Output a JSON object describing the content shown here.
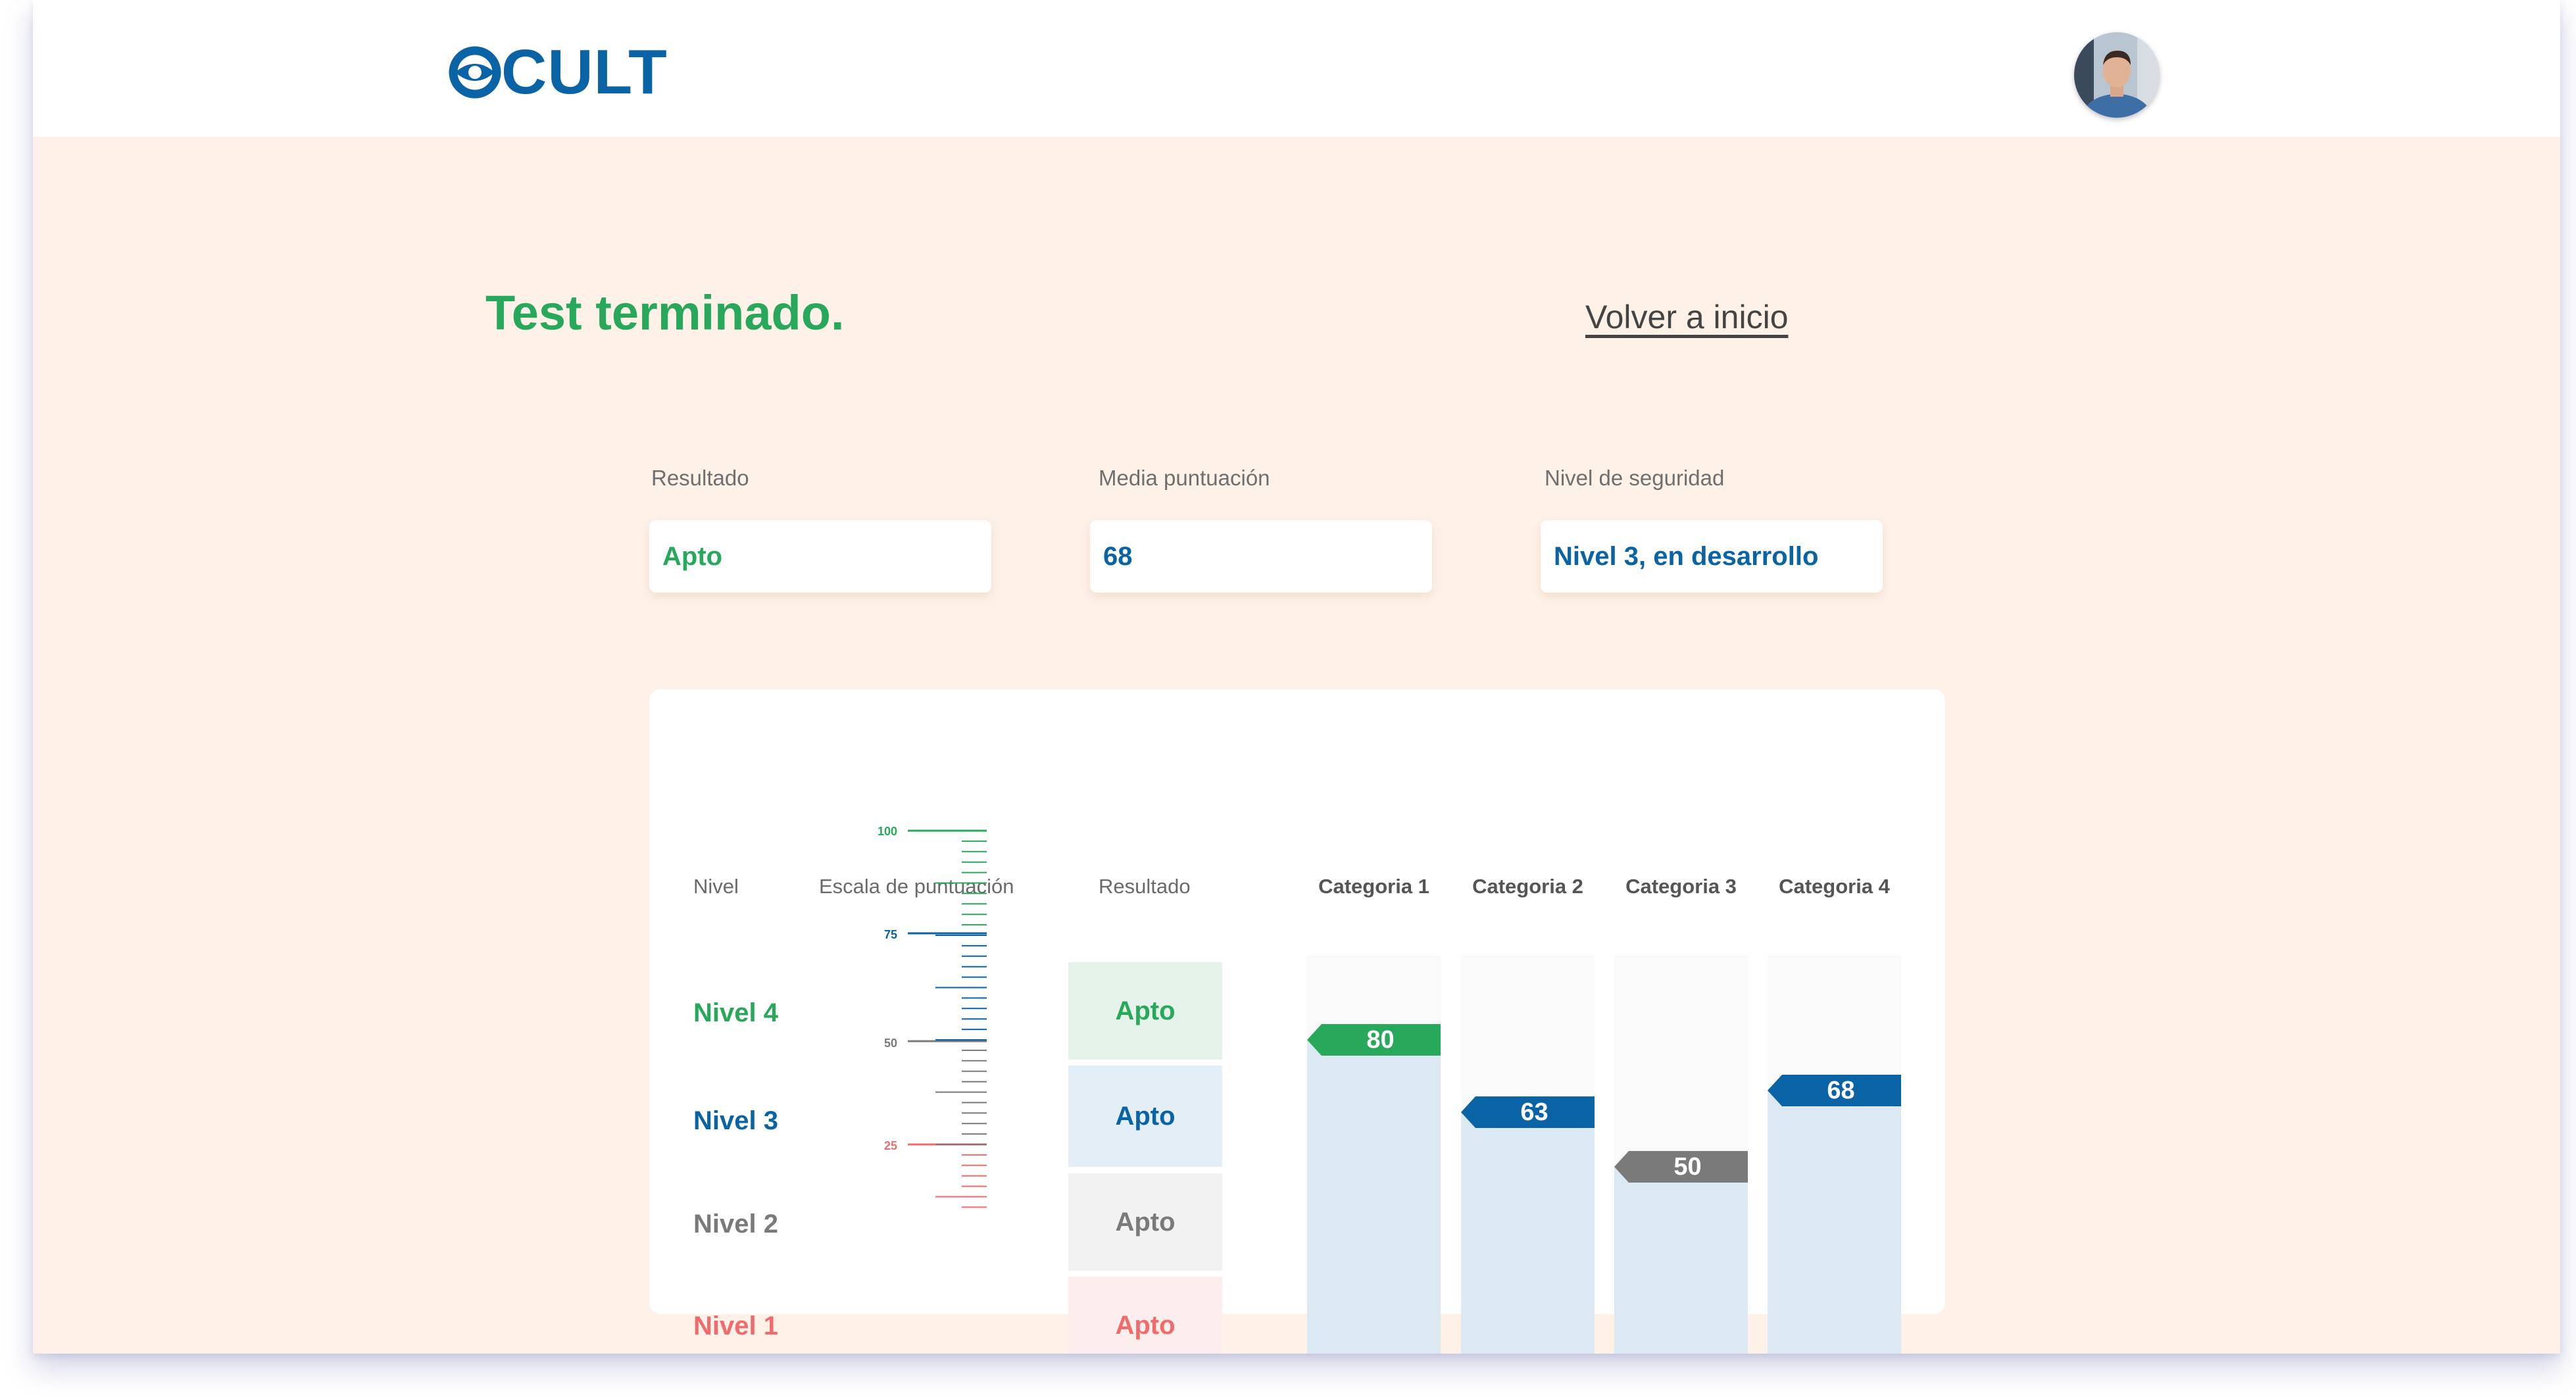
{
  "header": {
    "logo_text": "CULT",
    "logo_icon": "eye-icon",
    "brand_color": "#0a63a4",
    "avatar_icon": "user-avatar"
  },
  "main": {
    "title": "Test terminado.",
    "back_link": "Volver a inicio"
  },
  "summary": {
    "resultado_label": "Resultado",
    "resultado_value": "Apto",
    "media_label": "Media puntuación",
    "media_value": "68",
    "nivel_label": "Nivel de seguridad",
    "nivel_value": "Nivel 3, en desarrollo"
  },
  "table": {
    "headers": {
      "nivel": "Nivel",
      "escala": "Escala de puntuación",
      "resultado": "Resultado"
    },
    "levels": [
      {
        "label": "Nivel 4",
        "result": "Apto",
        "color": "#27a85a",
        "bg": "#e5f3ea"
      },
      {
        "label": "Nivel 3",
        "result": "Apto",
        "color": "#0a63a4",
        "bg": "#e4eef6"
      },
      {
        "label": "Nivel 2",
        "result": "Apto",
        "color": "#7a7a7a",
        "bg": "#f2f2f2"
      },
      {
        "label": "Nivel 1",
        "result": "Apto",
        "color": "#f06b6b",
        "bg": "#fdeeee"
      }
    ],
    "scale_ticks": [
      {
        "value": "100",
        "color": "#27a85a"
      },
      {
        "value": "75",
        "color": "#0a63a4"
      },
      {
        "value": "50",
        "color": "#7a7a7a"
      },
      {
        "value": "25",
        "color": "#f06b6b"
      }
    ]
  },
  "chart_data": {
    "type": "bar",
    "categories": [
      "Categoria 1",
      "Categoria 2",
      "Categoria 3",
      "Categoria 4"
    ],
    "values": [
      80,
      63,
      50,
      68
    ],
    "value_labels": [
      "80",
      "63",
      "50",
      "68"
    ],
    "colors": [
      "#27a85a",
      "#0a63a4",
      "#7a7a7a",
      "#0a63a4"
    ],
    "ylim": [
      0,
      100
    ]
  }
}
